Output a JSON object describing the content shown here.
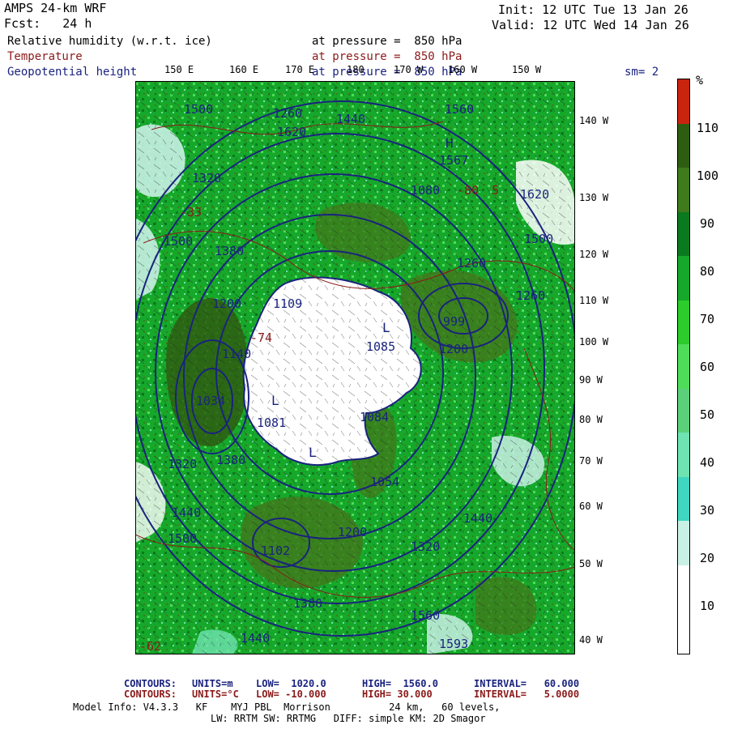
{
  "header": {
    "model": "AMPS 24-km WRF",
    "forecast": "Fcst:   24 h",
    "init": "Init: 12 UTC Tue 13 Jan 26",
    "valid": "Valid: 12 UTC Wed 14 Jan 26"
  },
  "fields": [
    {
      "name": "Relative humidity (w.r.t. ice)",
      "level": "at pressure =  850 hPa",
      "color": "#000000"
    },
    {
      "name": "Temperature",
      "level": "at pressure =  850 hPa",
      "color": "#8b1a1a"
    },
    {
      "name": "Geopotential height",
      "level": "at pressure =  850 hPa",
      "color": "#1a237e"
    }
  ],
  "smoothing": "sm= 2",
  "lon_labels_top": [
    "150 E",
    "160 E",
    "170 E",
    "180",
    "170 W",
    "160 W",
    "150 W"
  ],
  "lon_labels_right": [
    "140 W",
    "130 W",
    "120 W",
    "110 W",
    "100 W",
    "90 W",
    "80 W",
    "70 W",
    "60 W",
    "50 W",
    "40 W"
  ],
  "colorbar": {
    "unit": "%",
    "ticks": [
      "110",
      "100",
      "90",
      "80",
      "70",
      "60",
      "50",
      "40",
      "30",
      "20",
      "10"
    ],
    "colors": [
      "#c8240e",
      "#2e5d12",
      "#3f7a1c",
      "#0b7a1e",
      "#16a82a",
      "#2bcc2b",
      "#4fdc59",
      "#5ccf7b",
      "#6fe3b1",
      "#3fd6c2",
      "#c8f0e4",
      "#ffffff",
      "#ffffff"
    ]
  },
  "map_labels": {
    "heights": [
      "1500",
      "1560",
      "1620",
      "1320",
      "1440",
      "1500",
      "1380",
      "1260",
      "1200",
      "1140",
      "1080",
      "999",
      "1034",
      "1081",
      "1109",
      "1085",
      "1054",
      "1084",
      "1102",
      "1200",
      "1260",
      "1320",
      "1380",
      "1440",
      "1500",
      "1560",
      "1567",
      "1620",
      "1593",
      "1500",
      "1440",
      "1380",
      "1260",
      "1320",
      "1200",
      "1440"
    ],
    "temps": [
      "-33",
      "-74",
      "-80",
      "5",
      "-62"
    ],
    "markers": [
      "L",
      "H",
      "L",
      "L"
    ]
  },
  "footer": {
    "contours1": {
      "label": "CONTOURS:",
      "units": "UNITS=m",
      "low": "LOW=  1020.0",
      "high": "HIGH=  1560.0",
      "interval": "INTERVAL=   60.000",
      "color": "#1a237e"
    },
    "contours2": {
      "label": "CONTOURS:",
      "units": "UNITS=°C",
      "low": "LOW= -10.000",
      "high": "HIGH= 30.000",
      "interval": "INTERVAL=   5.0000",
      "color": "#8b1a1a"
    },
    "model_info": "Model Info: V4.3.3   KF    MYJ PBL  Morrison          24 km,   60 levels,",
    "model_info2": "LW: RRTM SW: RRTMG   DIFF: simple KM: 2D Smagor"
  }
}
